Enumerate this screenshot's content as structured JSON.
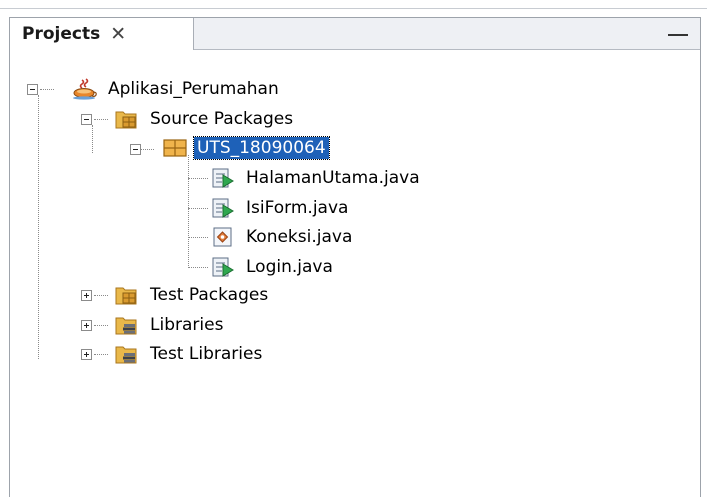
{
  "panel": {
    "tab_title": "Projects",
    "close_glyph": "✕"
  },
  "tree": {
    "project": {
      "label": "Aplikasi_Perumahan",
      "icon": "java-project-icon",
      "expanded": true
    },
    "source_packages": {
      "label": "Source Packages",
      "icon": "source-packages-folder-icon",
      "expanded": true
    },
    "package": {
      "label": "UTS_18090064",
      "icon": "package-icon",
      "expanded": true,
      "selected": true
    },
    "files": [
      {
        "label": "HalamanUtama.java",
        "icon": "jframe-form-icon"
      },
      {
        "label": "IsiForm.java",
        "icon": "jframe-form-icon"
      },
      {
        "label": "Koneksi.java",
        "icon": "java-class-icon"
      },
      {
        "label": "Login.java",
        "icon": "jframe-form-icon"
      }
    ],
    "test_packages": {
      "label": "Test Packages",
      "icon": "test-packages-folder-icon",
      "expanded": false
    },
    "libraries": {
      "label": "Libraries",
      "icon": "libraries-folder-icon",
      "expanded": false
    },
    "test_libraries": {
      "label": "Test Libraries",
      "icon": "test-libraries-folder-icon",
      "expanded": false
    }
  },
  "colors": {
    "selection": "#1e61b8",
    "folder": "#e9b84a",
    "package": "#e0a23a"
  }
}
